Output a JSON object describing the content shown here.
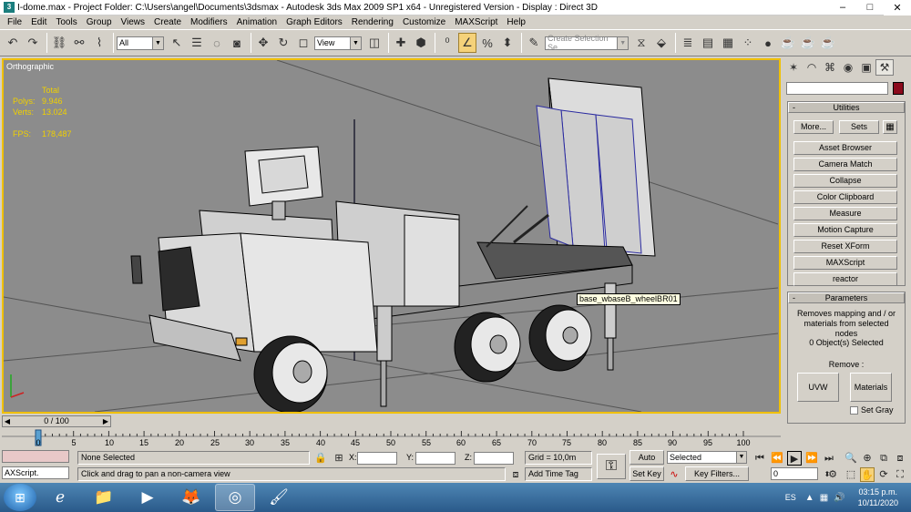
{
  "window": {
    "title": "I-dome.max    - Project Folder: C:\\Users\\angel\\Documents\\3dsmax    - Autodesk 3ds Max  2009 SP1  x64    - Unregistered Version    - Display : Direct 3D",
    "minimize": "–",
    "maximize": "□",
    "close": "✕"
  },
  "menu": [
    "File",
    "Edit",
    "Tools",
    "Group",
    "Views",
    "Create",
    "Modifiers",
    "Animation",
    "Graph Editors",
    "Rendering",
    "Customize",
    "MAXScript",
    "Help"
  ],
  "toolbar": {
    "selection_filter": "All",
    "reference_coord": "View",
    "named_selection_placeholder": "Create Selection Se"
  },
  "viewport": {
    "label": "Orthographic",
    "stats": {
      "header": "Total",
      "polys_label": "Polys:",
      "polys": "9.946",
      "verts_label": "Verts:",
      "verts": "13.024",
      "fps_label": "FPS:",
      "fps": "178,487"
    },
    "tooltip": "base_wbaseB_wheelBR01"
  },
  "command_panel": {
    "utilities": {
      "title": "Utilities",
      "more": "More...",
      "sets": "Sets",
      "buttons": [
        "Asset Browser",
        "Camera Match",
        "Collapse",
        "Color Clipboard",
        "Measure",
        "Motion Capture",
        "Reset XForm",
        "MAXScript",
        "reactor"
      ]
    },
    "parameters": {
      "title": "Parameters",
      "description": "Removes mapping and / or materials from selected nodes",
      "selected": "0 Object(s) Selected",
      "remove_label": "Remove :",
      "uvw": "UVW",
      "materials": "Materials",
      "set_gray": "Set Gray"
    }
  },
  "timeline": {
    "slider": "0 / 100",
    "ticks": [
      "0",
      "5",
      "10",
      "15",
      "20",
      "25",
      "30",
      "35",
      "40",
      "45",
      "50",
      "55",
      "60",
      "65",
      "70",
      "75",
      "80",
      "85",
      "90",
      "95",
      "100"
    ]
  },
  "status": {
    "maxscript_label": "AXScript.",
    "selection": "None Selected",
    "prompt": "Click and drag to pan a non-camera view",
    "x_label": "X:",
    "y_label": "Y:",
    "z_label": "Z:",
    "grid": "Grid = 10,0m",
    "add_time_tag": "Add Time Tag",
    "auto_key": "Auto Key",
    "set_key": "Set Key",
    "key_mode": "Selected",
    "key_filters": "Key Filters...",
    "frame": "0"
  },
  "taskbar": {
    "lang": "ES",
    "time": "03:15 p.m.",
    "date": "10/11/2020"
  },
  "colors": {
    "viewport_bg": "#8c8c8c",
    "active_border": "#f0c000",
    "stats_text": "#f0d000",
    "object_color": "#8b0a1c"
  }
}
